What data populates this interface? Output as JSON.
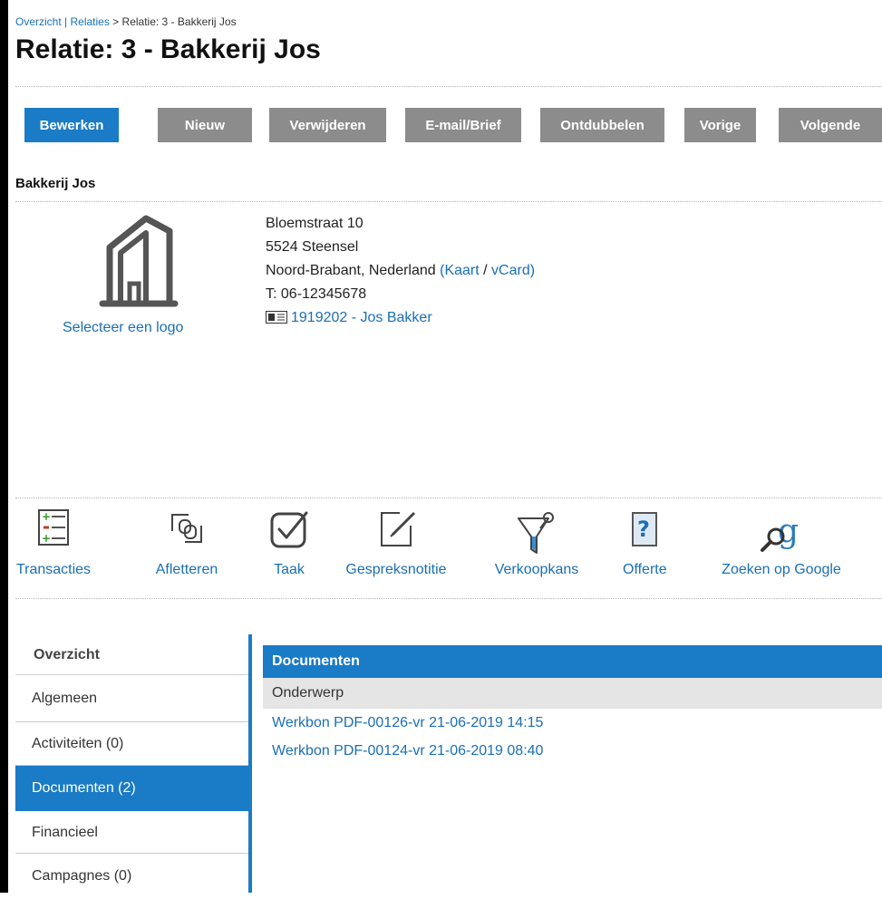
{
  "breadcrumb": {
    "overview": "Overzicht",
    "separator1": " | ",
    "relations": "Relaties",
    "separator2": " > ",
    "current": "Relatie: 3 - Bakkerij Jos"
  },
  "page_title": "Relatie: 3 - Bakkerij Jos",
  "toolbar": {
    "edit": "Bewerken",
    "new": "Nieuw",
    "delete": "Verwijderen",
    "mail": "E-mail/Brief",
    "dedupe": "Ontdubbelen",
    "previous": "Vorige",
    "next": "Volgende"
  },
  "colors": {
    "primary": "#1a7bc6",
    "button_gray": "#8c8c8c",
    "link": "#1a6fb5"
  },
  "relation": {
    "name": "Bakkerij Jos",
    "select_logo": "Selecteer een logo",
    "street": "Bloemstraat 10",
    "city": "5524 Steensel",
    "region": "Noord-Brabant, Nederland",
    "map_link": "Kaart",
    "vcard_link": "vCard",
    "phone": "T: 06-12345678",
    "contact": "1919202 - Jos Bakker",
    "logo_icon": "building-icon"
  },
  "actions": [
    {
      "label": "Transacties",
      "icon": "transactions-icon"
    },
    {
      "label": "Afletteren",
      "icon": "link-icon"
    },
    {
      "label": "Taak",
      "icon": "task-check-icon"
    },
    {
      "label": "Gespreksnotitie",
      "icon": "note-edit-icon"
    },
    {
      "label": "Verkoopkans",
      "icon": "funnel-icon"
    },
    {
      "label": "Offerte",
      "icon": "quote-icon"
    },
    {
      "label": "Zoeken op Google",
      "icon": "google-search-icon"
    }
  ],
  "sidebar": {
    "header": "Overzicht",
    "items": [
      {
        "label": "Algemeen"
      },
      {
        "label": "Activiteiten (0)"
      },
      {
        "label": "Documenten (2)",
        "active": true
      },
      {
        "label": "Financieel"
      },
      {
        "label": "Campagnes (0)"
      }
    ]
  },
  "documents": {
    "title": "Documenten",
    "column": "Onderwerp",
    "rows": [
      "Werkbon PDF-00126-vr 21-06-2019 14:15",
      "Werkbon PDF-00124-vr 21-06-2019 08:40"
    ]
  }
}
